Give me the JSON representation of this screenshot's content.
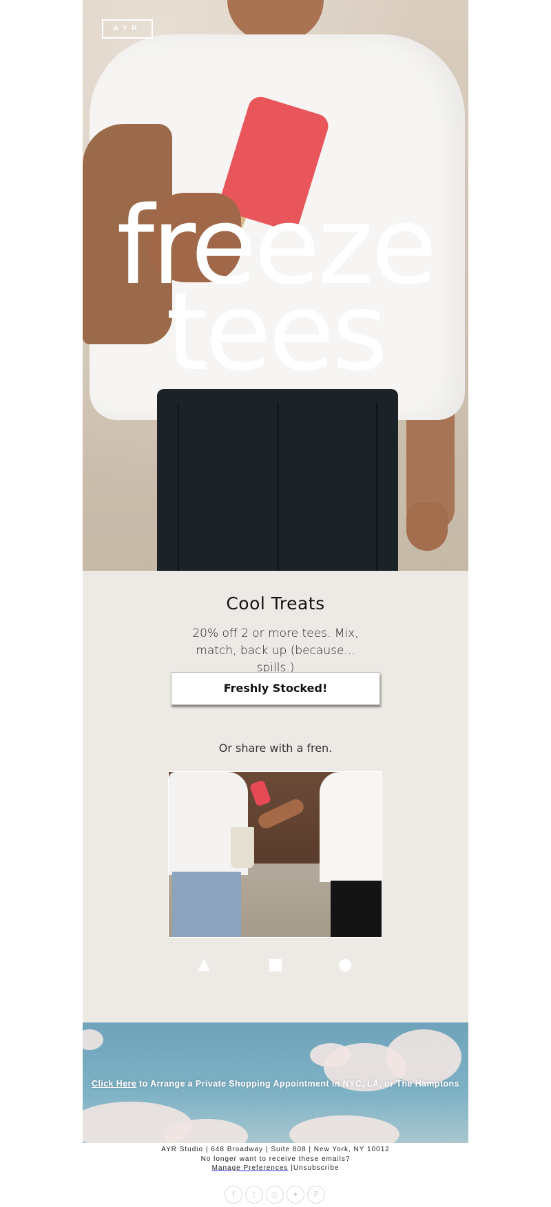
{
  "hero": {
    "logo": "AYR",
    "title_line1": "freeze",
    "title_line2": "tees"
  },
  "promo": {
    "heading": "Cool Treats",
    "description": "20% off 2 or more tees. Mix, match, back up (because... spills.)",
    "cta_label": "Freshly Stocked!",
    "share_text": "Or share with a fren."
  },
  "banner": {
    "link_text": "Click Here",
    "text": " to Arrange a Private Shopping Appointment in NYC, LA, or The Hamptons"
  },
  "footer": {
    "address": "AYR Studio | 648 Broadway | Suite 808 | New York, NY 10012",
    "unsubscribe_prompt": "No longer want to receive these emails?",
    "manage_preferences": "Manage Preferences",
    "separator": " |",
    "unsubscribe": "Unsubscribe"
  },
  "social": {
    "icons": [
      "facebook-icon",
      "tumblr-icon",
      "instagram-icon",
      "twitter-icon",
      "pinterest-icon"
    ],
    "glyphs": [
      "f",
      "t",
      "◎",
      "✦",
      "P"
    ]
  },
  "colors": {
    "promo_bg": "#edeae6",
    "pants": "#1b2329",
    "popsicle": "#e8565c",
    "sky": "#7fb2c6"
  }
}
